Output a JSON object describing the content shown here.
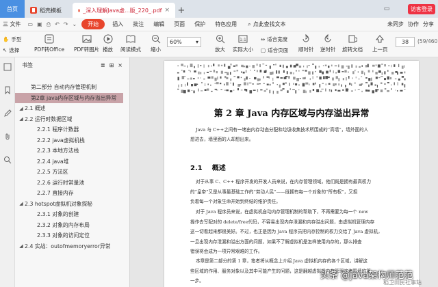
{
  "tabs": {
    "home": "首页",
    "tab1": "稻壳模板",
    "tab2": "_深入理解Java虚...版_220_.pdf",
    "user_badge": "访客登录"
  },
  "menu": {
    "file": "三 文件",
    "items": [
      "开始",
      "插入",
      "批注",
      "编辑",
      "页面",
      "保护",
      "特色应用"
    ],
    "search": "点此查找文本",
    "right": [
      "未同步",
      "协作",
      "分享"
    ]
  },
  "toolbar": {
    "hand": "手型",
    "select": "选择",
    "pdf_to_office": "PDF转Office",
    "pdf_to_image": "PDF转图片",
    "play": "播放",
    "read_mode": "阅读模式",
    "shrink": "缩小",
    "zoom": "60%",
    "enlarge": "放大",
    "actual_size": "实际大小",
    "fit_width": "适合宽度",
    "fit_page": "适合页面",
    "rotate_cw": "顺时针",
    "rotate_ccw": "逆时针",
    "rotate_doc": "旋转文档",
    "prev_page": "上一页",
    "single_page": "单页",
    "page": "38",
    "page_total": "(59/460"
  },
  "sidebar": {
    "title": "书签",
    "toc": [
      {
        "indent": 1,
        "arrow": "",
        "label": "第二部分  自动内存管理机制",
        "sel": false
      },
      {
        "indent": 1,
        "arrow": "",
        "label": "第2章   java内存区域与内存溢出异常",
        "sel": true
      },
      {
        "indent": 0,
        "arrow": "◢",
        "label": "2.1   概述",
        "sel": false
      },
      {
        "indent": 0,
        "arrow": "◢",
        "label": "2.2   运行时数据区域",
        "sel": false
      },
      {
        "indent": 2,
        "arrow": "",
        "label": "2.2.1   程序计数器",
        "sel": false
      },
      {
        "indent": 2,
        "arrow": "",
        "label": "2.2.2   java虚拟机栈",
        "sel": false
      },
      {
        "indent": 2,
        "arrow": "",
        "label": "2.2.3   本地方法栈",
        "sel": false
      },
      {
        "indent": 2,
        "arrow": "",
        "label": "2.2.4   java堆",
        "sel": false
      },
      {
        "indent": 2,
        "arrow": "",
        "label": "2.2.5   方法区",
        "sel": false
      },
      {
        "indent": 2,
        "arrow": "",
        "label": "2.2.6   运行时常量池",
        "sel": false
      },
      {
        "indent": 2,
        "arrow": "",
        "label": "2.2.7   直接内存",
        "sel": false
      },
      {
        "indent": 0,
        "arrow": "◢",
        "label": "2.3   hotspot虚拟机对象探秘",
        "sel": false
      },
      {
        "indent": 2,
        "arrow": "",
        "label": "2.3.1   对象的创建",
        "sel": false
      },
      {
        "indent": 2,
        "arrow": "",
        "label": "2.3.2   对象的内存布局",
        "sel": false
      },
      {
        "indent": 2,
        "arrow": "",
        "label": "2.3.3   对象的访问定位",
        "sel": false
      },
      {
        "indent": 0,
        "arrow": "◢",
        "label": "2.4   实战：outofmemoryerror异常",
        "sel": false
      }
    ]
  },
  "document": {
    "chapter": "第 2 章   Java 内存区域与内存溢出异常",
    "intro": [
      "Java 与 C++之间有一堵由内存动态分配和垃圾收集技术所围成的“高墙”，墙外面的人",
      "想进去，墙里面的人却想出来。"
    ],
    "section_num": "2.1",
    "section_title": "概述",
    "para1": [
      "对于从事 C、C++ 程序开发的开发人员来说，在内存管理领域，他们既是拥有最高权力",
      "的“皇帝”又是从事最基础工作的“劳动人民”——既拥有每一个对象的“所有权”，又担",
      "负着每一个对象生命开始到终结的维护责任。"
    ],
    "para2": [
      "对于 Java 程序员来说，在虚拟机自动内存管理机制的帮助下，不再需要为每一个 new",
      "操作去写配对的 delete/free代码，不容易出现内存泄漏和内存溢出问题，由虚拟机管理内存",
      "这一切看起来都很美好。不过，也正是因为 Java 程序员把内存控制的权力交给了 Java 虚拟机，",
      "一旦出现内存泄漏和溢出方面的问题，如果不了解虚拟机是怎样使用内存的，那么排查",
      "错误将会成为一项异常艰难的工作。"
    ],
    "para3": [
      "本章是第二部分的第 1 章，笔者将从概念上介绍 Java 虚拟机内存的各个区域，讲解这",
      "些区域的作用、服务对象以及其中可能产生的问题，这是翻越虚拟机内存管理这堵围墙的第",
      "一步。"
    ]
  },
  "watermark": {
    "text": "头条 @java架构师范范",
    "sub": "稻卫田民社事站"
  }
}
